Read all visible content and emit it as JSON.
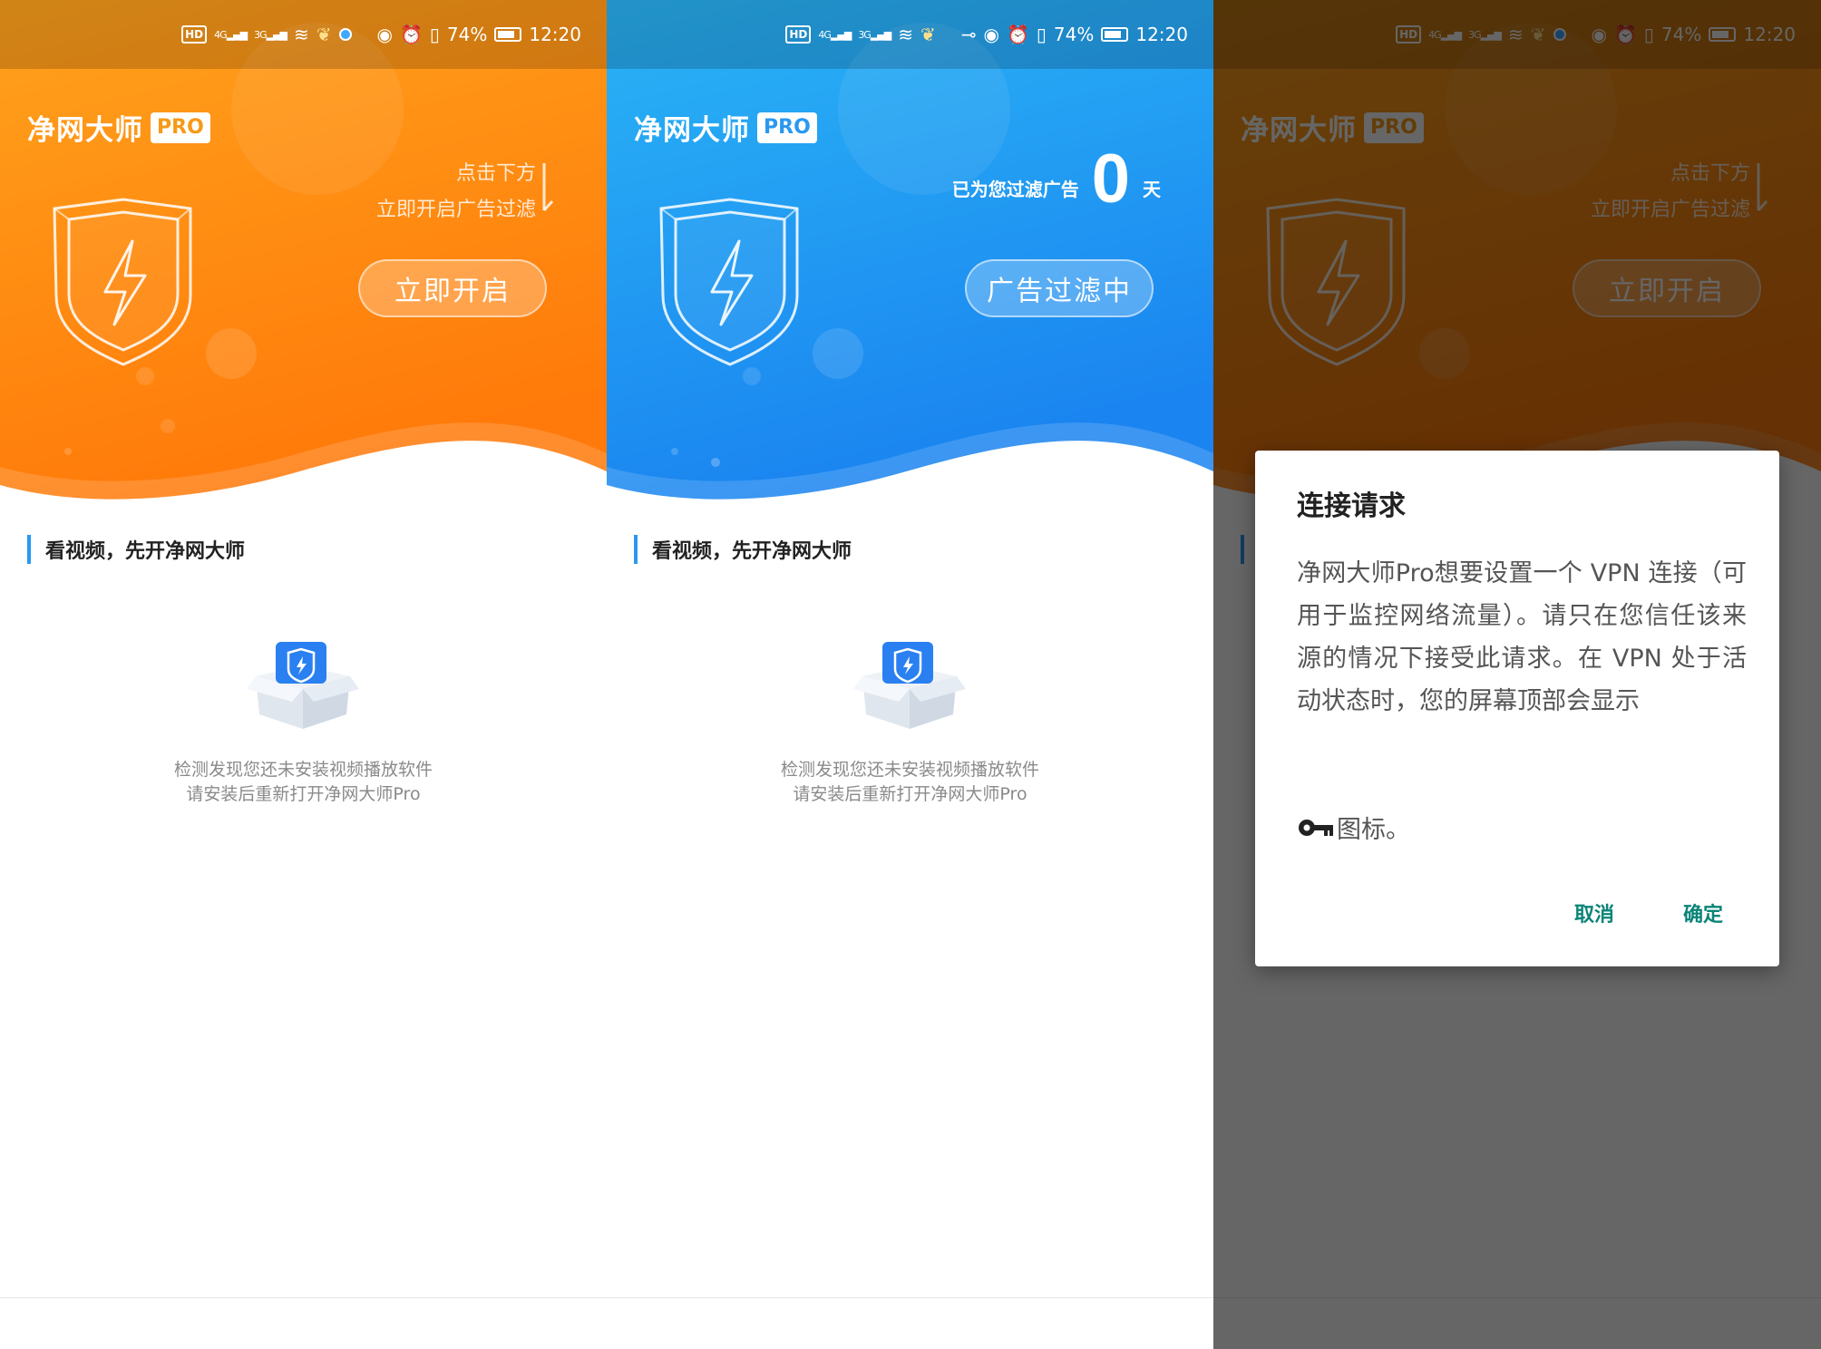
{
  "status_bar": {
    "hd": "HD",
    "sig1": "4G",
    "sig2": "3G",
    "battery": "74%",
    "time": "12:20"
  },
  "app": {
    "name": "净网大师",
    "badge": "PRO"
  },
  "off_state": {
    "hint_line1": "点击下方",
    "hint_line2": "立即开启广告过滤",
    "button": "立即开启"
  },
  "on_state": {
    "filtered_label": "已为您过滤广告",
    "days": "0",
    "unit": "天",
    "button": "广告过滤中"
  },
  "section": {
    "title": "看视频，先开净网大师",
    "empty_line1": "检测发现您还未安装视频播放软件",
    "empty_line2": "请安装后重新打开净网大师Pro"
  },
  "dialog": {
    "title": "连接请求",
    "body": "净网大师Pro想要设置一个 VPN 连接（可用于监控网络流量）。请只在您信任该来源的情况下接受此请求。在 VPN 处于活动状态时，您的屏幕顶部会显示",
    "icon_text": "图标。",
    "cancel": "取消",
    "ok": "确定"
  },
  "colors": {
    "orange_top": "#ffa21c",
    "orange_bottom": "#ff7a0a",
    "blue_top": "#2ab4f5",
    "blue_bottom": "#1a84f0",
    "accent_blue": "#2a98f0",
    "dialog_button": "#0b8478"
  },
  "icons": [
    "hd-icon",
    "signal-4g-icon",
    "signal-3g-icon",
    "wifi-icon",
    "vpn-key-icon",
    "eye-icon",
    "alarm-icon",
    "vibrate-icon",
    "battery-icon",
    "shield-bolt-icon",
    "arrow-down-icon",
    "box-icon",
    "key-icon"
  ]
}
